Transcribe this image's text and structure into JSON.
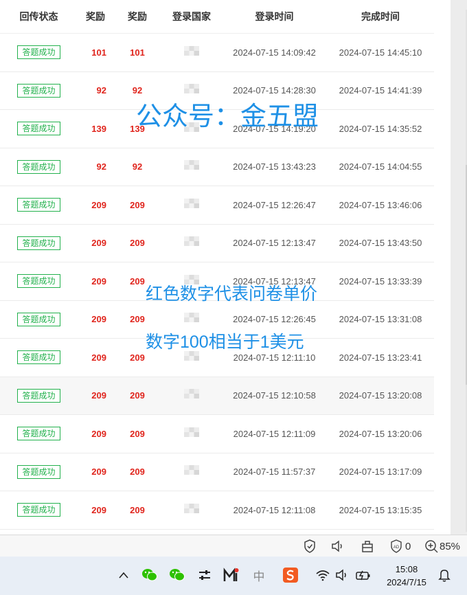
{
  "table": {
    "headers": [
      "回传状态",
      "奖励",
      "奖励",
      "登录国家",
      "登录时间",
      "完成时间"
    ],
    "rows": [
      {
        "status": "答题成功",
        "reward_a": "101",
        "reward_b": "101",
        "login": "2024-07-15 14:09:42",
        "done": "2024-07-15 14:45:10"
      },
      {
        "status": "答题成功",
        "reward_a": "92",
        "reward_b": "92",
        "login": "2024-07-15 14:28:30",
        "done": "2024-07-15 14:41:39"
      },
      {
        "status": "答题成功",
        "reward_a": "139",
        "reward_b": "139",
        "login": "2024-07-15 14:19:20",
        "done": "2024-07-15 14:35:52"
      },
      {
        "status": "答题成功",
        "reward_a": "92",
        "reward_b": "92",
        "login": "2024-07-15 13:43:23",
        "done": "2024-07-15 14:04:55"
      },
      {
        "status": "答题成功",
        "reward_a": "209",
        "reward_b": "209",
        "login": "2024-07-15 12:26:47",
        "done": "2024-07-15 13:46:06"
      },
      {
        "status": "答题成功",
        "reward_a": "209",
        "reward_b": "209",
        "login": "2024-07-15 12:13:47",
        "done": "2024-07-15 13:43:50"
      },
      {
        "status": "答题成功",
        "reward_a": "209",
        "reward_b": "209",
        "login": "2024-07-15 12:13:47",
        "done": "2024-07-15 13:33:39"
      },
      {
        "status": "答题成功",
        "reward_a": "209",
        "reward_b": "209",
        "login": "2024-07-15 12:26:45",
        "done": "2024-07-15 13:31:08"
      },
      {
        "status": "答题成功",
        "reward_a": "209",
        "reward_b": "209",
        "login": "2024-07-15 12:11:10",
        "done": "2024-07-15 13:23:41"
      },
      {
        "status": "答题成功",
        "reward_a": "209",
        "reward_b": "209",
        "login": "2024-07-15 12:10:58",
        "done": "2024-07-15 13:20:08"
      },
      {
        "status": "答题成功",
        "reward_a": "209",
        "reward_b": "209",
        "login": "2024-07-15 12:11:09",
        "done": "2024-07-15 13:20:06"
      },
      {
        "status": "答题成功",
        "reward_a": "209",
        "reward_b": "209",
        "login": "2024-07-15 11:57:37",
        "done": "2024-07-15 13:17:09"
      },
      {
        "status": "答题成功",
        "reward_a": "209",
        "reward_b": "209",
        "login": "2024-07-15 12:11:08",
        "done": "2024-07-15 13:15:35"
      }
    ]
  },
  "overlay": {
    "line1": "公众号：金五盟",
    "line2": "红色数字代表问卷单价",
    "line3": "数字100相当于1美元"
  },
  "statusbar": {
    "ads_count": "0",
    "zoom": "85%"
  },
  "taskbar": {
    "time": "15:08",
    "date": "2024/7/15",
    "ime_label": "中"
  },
  "colors": {
    "accent_green": "#22b14c",
    "reward_red": "#e0251d",
    "overlay_blue": "#1e90e6"
  }
}
